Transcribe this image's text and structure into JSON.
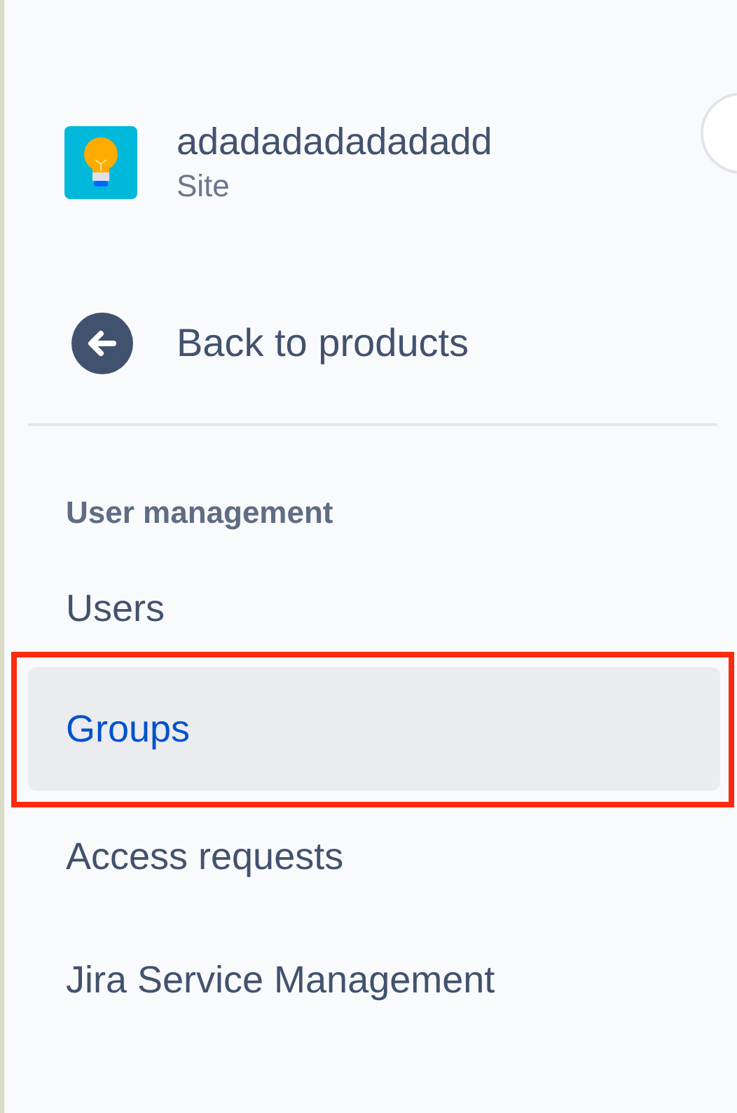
{
  "site": {
    "name": "adadadadadadadd",
    "type": "Site"
  },
  "back_link": {
    "label": "Back to products"
  },
  "section": {
    "title": "User management"
  },
  "nav_items": [
    {
      "label": "Users",
      "selected": false,
      "highlighted": false
    },
    {
      "label": "Groups",
      "selected": true,
      "highlighted": true
    },
    {
      "label": "Access requests",
      "selected": false,
      "highlighted": false
    },
    {
      "label": "Jira Service Management",
      "selected": false,
      "highlighted": false
    }
  ]
}
